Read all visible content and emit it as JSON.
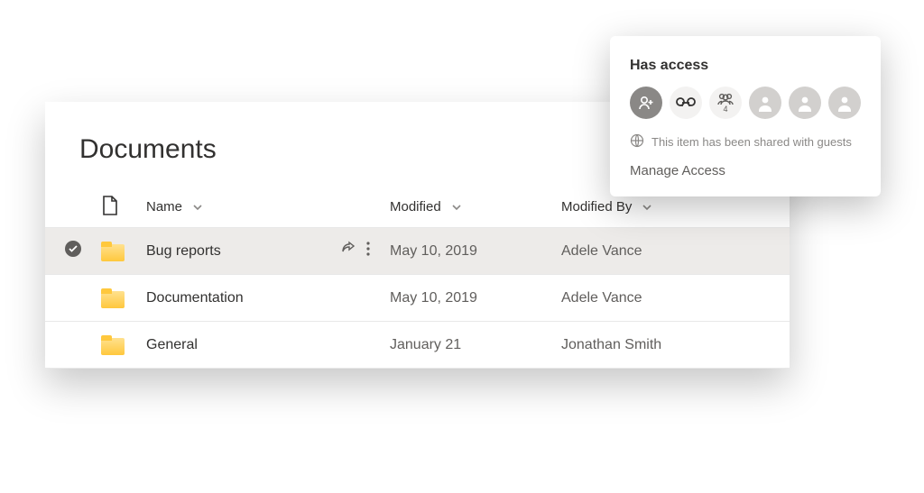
{
  "panel": {
    "title": "Documents",
    "columns": {
      "name": "Name",
      "modified": "Modified",
      "modifiedBy": "Modified By"
    },
    "rows": [
      {
        "name": "Bug reports",
        "modified": "May 10, 2019",
        "modifiedBy": "Adele Vance",
        "selected": true
      },
      {
        "name": "Documentation",
        "modified": "May 10, 2019",
        "modifiedBy": "Adele Vance",
        "selected": false
      },
      {
        "name": "General",
        "modified": "January 21",
        "modifiedBy": "Jonathan Smith",
        "selected": false
      }
    ]
  },
  "popover": {
    "title": "Has access",
    "groupCount": "4",
    "guestNotice": "This item has been shared with guests",
    "manage": "Manage Access"
  }
}
